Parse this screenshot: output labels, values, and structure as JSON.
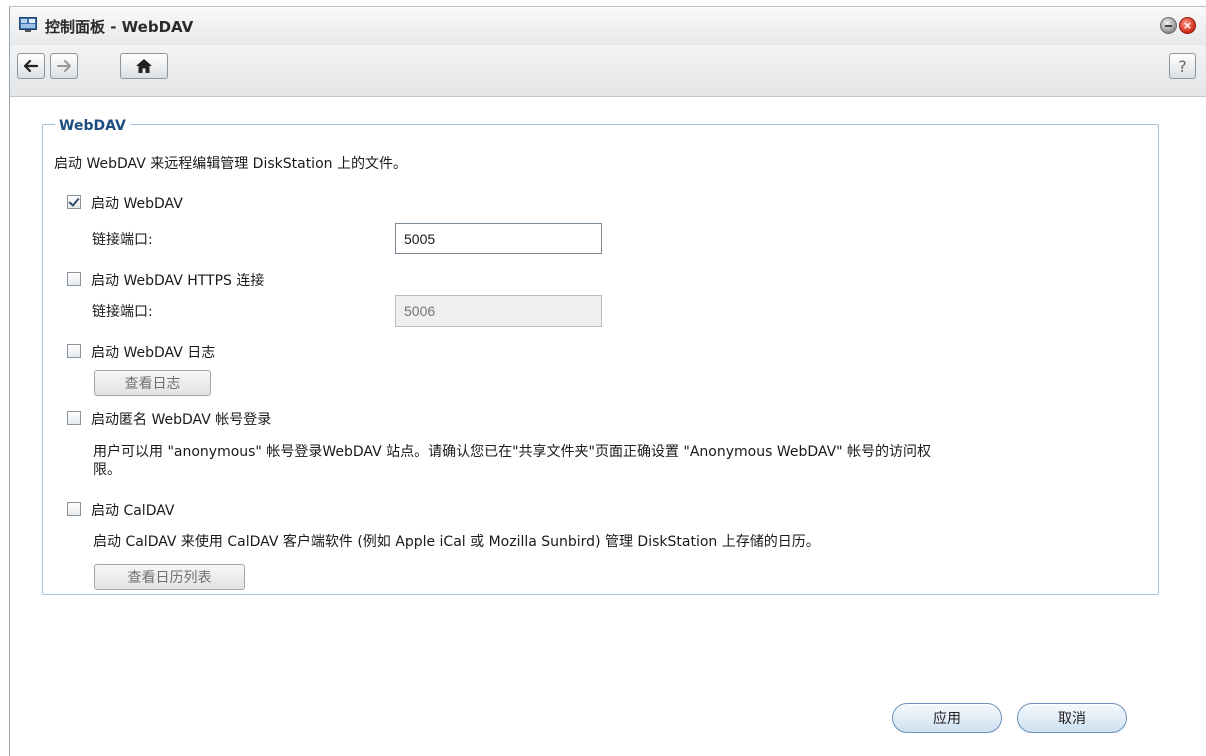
{
  "window": {
    "title": "控制面板 - WebDAV"
  },
  "toolbar": {
    "back_icon": "arrow-left-icon",
    "forward_icon": "arrow-right-icon",
    "home_icon": "home-icon",
    "help_label": "?"
  },
  "section": {
    "legend": "WebDAV",
    "description": "启动 WebDAV 来远程编辑管理 DiskStation 上的文件。"
  },
  "options": {
    "webdav": {
      "label": "启动 WebDAV",
      "checked": true
    },
    "webdav_port": {
      "label": "链接端口:",
      "value": "5005"
    },
    "https": {
      "label": "启动 WebDAV HTTPS 连接",
      "checked": false
    },
    "https_port": {
      "label": "链接端口:",
      "placeholder": "5006"
    },
    "log": {
      "label": "启动 WebDAV 日志",
      "checked": false,
      "button": "查看日志"
    },
    "anonymous": {
      "label": "启动匿名 WebDAV 帐号登录",
      "checked": false,
      "desc_line1": "用户可以用 \"anonymous\" 帐号登录WebDAV 站点。请确认您已在\"共享文件夹\"页面正确设置 \"Anonymous WebDAV\" 帐号的访问权",
      "desc_line2": "限。"
    },
    "caldav": {
      "label": "启动 CalDAV",
      "checked": false,
      "description": "启动 CalDAV 来使用 CalDAV 客户端软件 (例如 Apple iCal 或 Mozilla Sunbird) 管理 DiskStation 上存储的日历。",
      "button": "查看日历列表"
    }
  },
  "footer": {
    "apply": "应用",
    "cancel": "取消"
  },
  "colors": {
    "legend": "#1c4c80",
    "fieldset_border": "#a9c1d6",
    "close_button": "#d8301e"
  }
}
